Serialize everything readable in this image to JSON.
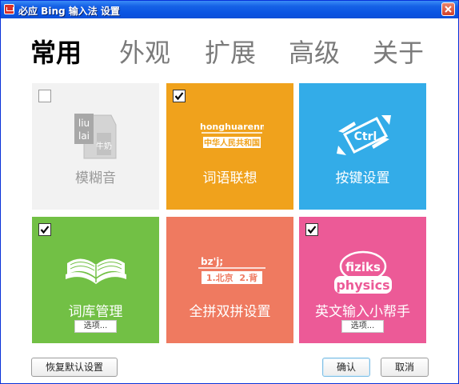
{
  "window": {
    "title": "必应 Bing 输入法 设置"
  },
  "tabs": [
    {
      "label": "常用",
      "active": true
    },
    {
      "label": "外观",
      "active": false
    },
    {
      "label": "扩展",
      "active": false
    },
    {
      "label": "高级",
      "active": false
    },
    {
      "label": "关于",
      "active": false
    }
  ],
  "tiles": [
    {
      "label": "模糊音",
      "checked": false,
      "color": "#f2f2f2",
      "icon": "liulai-carton-icon",
      "icon_text": {
        "line1": "liu",
        "line2": "lai",
        "carton": "牛奶"
      }
    },
    {
      "label": "词语联想",
      "checked": true,
      "color": "#f0a21c",
      "icon": "pinyin-banner-icon",
      "icon_text": {
        "pinyin": "zhonghuarenm",
        "hanzi": "中华人民共和国"
      }
    },
    {
      "label": "按键设置",
      "checked": null,
      "color": "#33ace8",
      "icon": "ctrl-key-icon",
      "icon_text": {
        "key": "Ctrl"
      }
    },
    {
      "label": "词库管理",
      "checked": true,
      "color": "#72c045",
      "icon": "open-book-icon",
      "option_button": "选项..."
    },
    {
      "label": "全拼双拼设置",
      "checked": null,
      "color": "#ef7a60",
      "icon": "shuangpin-candidate-icon",
      "icon_text": {
        "input": "bz'j;",
        "candidates": "1.北京  2.背"
      }
    },
    {
      "label": "英文输入小帮手",
      "checked": true,
      "color": "#ec5a97",
      "icon": "fiziks-physics-icon",
      "icon_text": {
        "typed": "fiziks",
        "corrected": "physics"
      },
      "option_button": "选项..."
    }
  ],
  "footer": {
    "restore_label": "恢复默认设置",
    "ok_label": "确认",
    "cancel_label": "取消"
  }
}
